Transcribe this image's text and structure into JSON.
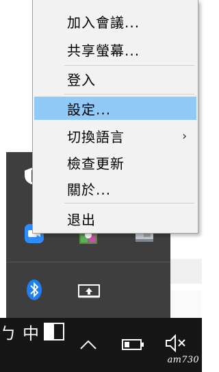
{
  "menu": {
    "items": [
      {
        "label": "加入會議..."
      },
      {
        "label": "共享螢幕..."
      },
      {
        "label": "登入"
      },
      {
        "label": "設定..."
      },
      {
        "label": "切換語言",
        "submenu_arrow": "›"
      },
      {
        "label": "檢查更新"
      },
      {
        "label": "關於..."
      },
      {
        "label": "退出"
      }
    ],
    "highlighted_item": "設定..."
  },
  "tray_flyout": {
    "icons": [
      "shield-icon",
      "zoom-meeting-icon",
      "colorful-app-icon",
      "device-manager-icon",
      "bluetooth-icon",
      "screen-share-icon"
    ]
  },
  "taskbar": {
    "ime_partial_char": "ㄅ",
    "ime_mode_char": "中",
    "icons": [
      "chevron-up-icon",
      "battery-icon",
      "speaker-muted-icon"
    ]
  },
  "watermark": "am730",
  "colors": {
    "menu_bg": "#f2f2f2",
    "highlight": "#91c9f7",
    "tray_bg": "#3e3e3e",
    "taskbar_bg": "#161616",
    "zoom_blue": "#2d8cff",
    "bluetooth_blue": "#1d7ff0"
  }
}
